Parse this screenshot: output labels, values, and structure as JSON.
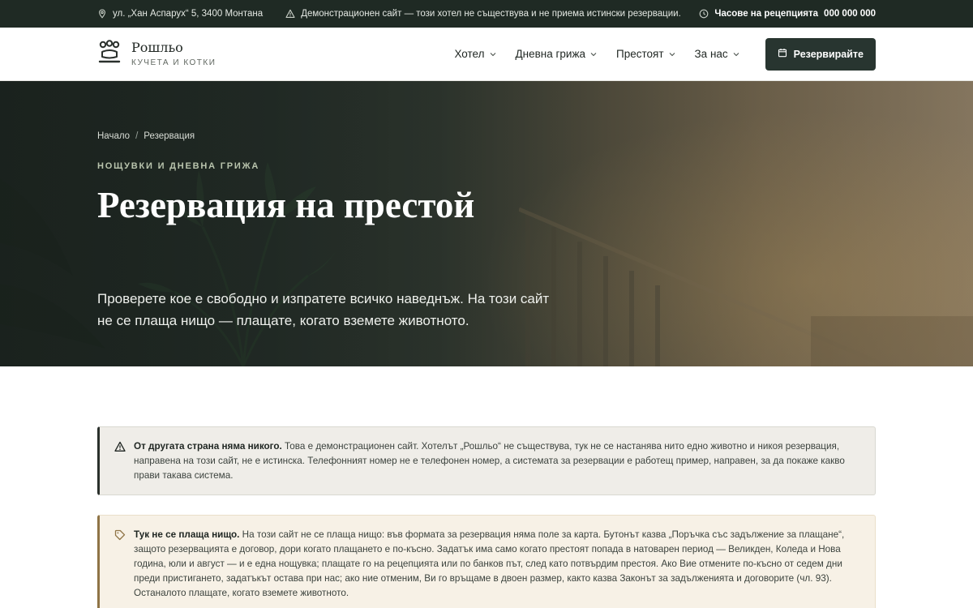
{
  "topbar": {
    "address": "ул. „Хан Аспарух“ 5, 3400 Монтана",
    "demo_notice": "Демонстрационен сайт — този хотел не съществува и не приема истински резервации.",
    "reception_label": "Часове на рецепцията",
    "reception_phone": "000 000 000"
  },
  "brand": {
    "name": "Рошльо",
    "tagline": "КУЧЕТА И КОТКИ"
  },
  "nav": {
    "items": [
      {
        "label": "Хотел"
      },
      {
        "label": "Дневна грижа"
      },
      {
        "label": "Престоят"
      },
      {
        "label": "За нас"
      }
    ],
    "book_label": "Резервирайте"
  },
  "hero": {
    "breadcrumb": [
      "Начало",
      "Резервация"
    ],
    "breadcrumb_separator": "/",
    "eyebrow": "НОЩУВКИ И ДНЕВНА ГРИЖА",
    "title": "Резервация на престой",
    "lead": "Проверете кое е свободно и изпратете всичко наведнъж. На този сайт не се плаща нищо — плащате, когато вземете животното."
  },
  "notices": [
    {
      "icon": "warning-icon",
      "title": "От другата страна няма никого.",
      "body": "Това е демонстрационен сайт. Хотелът „Рошльо“ не съществува, тук не се настанява нито едно животно и никоя резервация, направена на този сайт, не е истинска. Телефонният номер не е телефонен номер, а системата за резервации е работещ пример, направен, за да покаже какво прави такава система."
    },
    {
      "icon": "tag-icon",
      "title": "Тук не се плаща нищо.",
      "body": "На този сайт не се плаща нищо: във формата за резервация няма поле за карта. Бутонът казва „Поръчка със задължение за плащане“, защото резервацията е договор, дори когато плащането е по-късно. Задатък има само когато престоят попада в натоварен период — Великден, Коледа и Нова година, юли и август — и е една нощувка; плащате го на рецепцията или по банков път, след като потвърдим престоя. Ако Вие отмените по-късно от седем дни преди пристигането, задатъкът остава при нас; ако ние отменим, Ви го връщаме в двоен размер, както казва Законът за задълженията и договорите (чл. 93). Останалото плащате, когато вземете животното."
    }
  ],
  "colors": {
    "topbar_bg": "#1f2a24",
    "accent_dark": "#283530",
    "notice_warning_bg": "#efede8",
    "notice_payment_bg": "#f7f1e6",
    "notice_payment_border": "#8f7446"
  }
}
